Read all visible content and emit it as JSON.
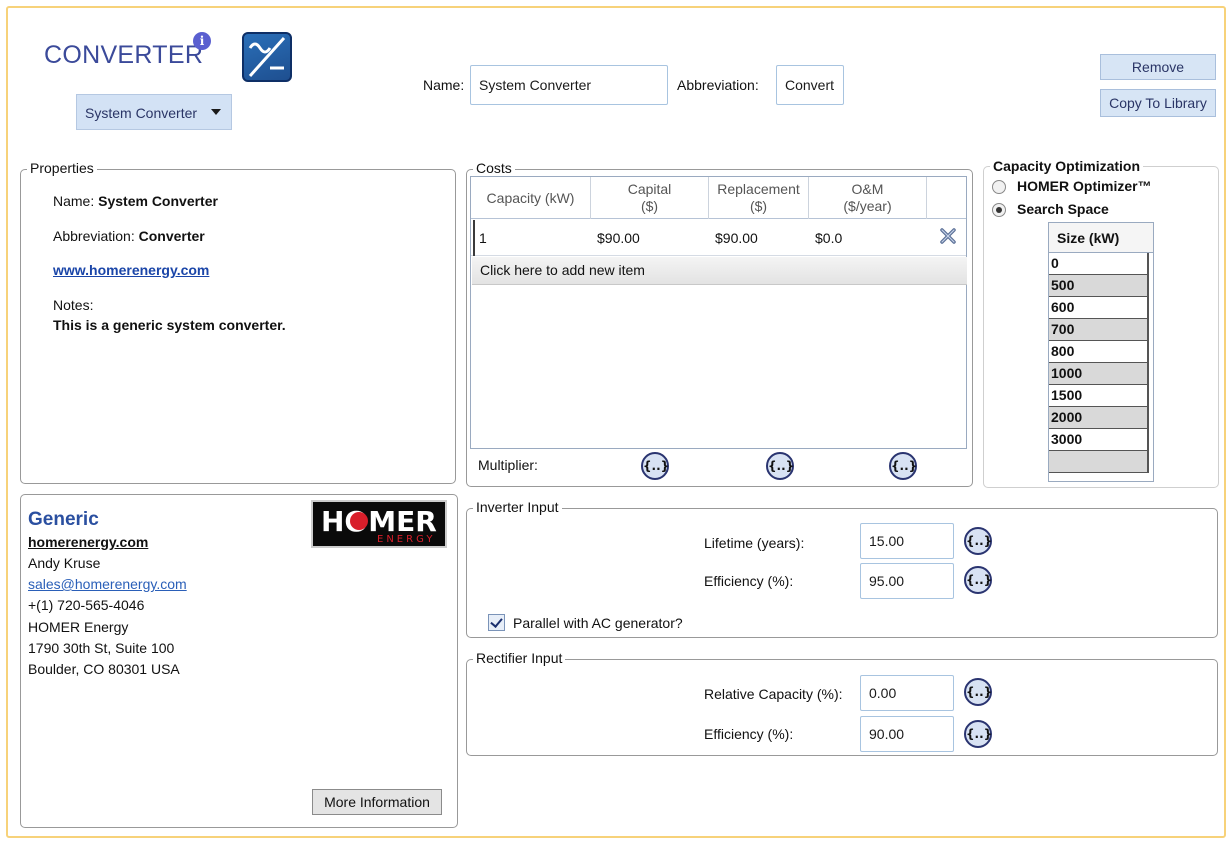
{
  "header": {
    "title": "CONVERTER",
    "type_selected": "System Converter",
    "name_label": "Name:",
    "name_value": "System Converter",
    "abbr_label": "Abbreviation:",
    "abbr_value": "Convert",
    "remove_label": "Remove",
    "copy_label": "Copy To Library"
  },
  "properties": {
    "legend": "Properties",
    "name_label": "Name:",
    "name_value": "System Converter",
    "abbr_label": "Abbreviation:",
    "abbr_value": "Converter",
    "website": "www.homerenergy.com",
    "notes_label": "Notes:",
    "notes_value": "This is a generic system converter."
  },
  "costs": {
    "legend": "Costs",
    "headers": [
      "Capacity (kW)",
      "Capital",
      "($)",
      "Replacement",
      "($)",
      "O&M",
      "($/year)"
    ],
    "rows": [
      {
        "capacity": "1",
        "capital": "$90.00",
        "replacement": "$90.00",
        "om": "$0.0"
      }
    ],
    "add_item": "Click here to add new item",
    "multiplier_label": "Multiplier:",
    "multiplier_glyph": "{..}"
  },
  "capacity_opt": {
    "legend": "Capacity Optimization",
    "option_optimizer": "HOMER Optimizer™",
    "option_search": "Search Space",
    "selected": "Search Space",
    "size_header": "Size (kW)",
    "sizes": [
      "0",
      "500",
      "600",
      "700",
      "800",
      "1000",
      "1500",
      "2000",
      "3000",
      ""
    ]
  },
  "vendor": {
    "name": "Generic",
    "website": "homerenergy.com",
    "contact": "Andy Kruse",
    "email": "sales@homerenergy.com",
    "phone": "+(1) 720-565-4046",
    "company": "HOMER Energy",
    "address1": "1790 30th St, Suite 100",
    "address2": "Boulder, CO 80301 USA",
    "logo_text": "HOMER",
    "logo_sub": "ENERGY",
    "more_info": "More Information"
  },
  "inverter": {
    "legend": "Inverter Input",
    "lifetime_label": "Lifetime (years):",
    "lifetime_value": "15.00",
    "efficiency_label": "Efficiency (%):",
    "efficiency_value": "95.00",
    "parallel_label": "Parallel with AC generator?",
    "parallel_checked": true
  },
  "rectifier": {
    "legend": "Rectifier Input",
    "relcap_label": "Relative Capacity (%):",
    "relcap_value": "0.00",
    "efficiency_label": "Efficiency (%):",
    "efficiency_value": "90.00"
  },
  "colors": {
    "accent": "#3b4a9a",
    "frame": "#f7d27a",
    "button_bg": "#d7e5f5"
  }
}
